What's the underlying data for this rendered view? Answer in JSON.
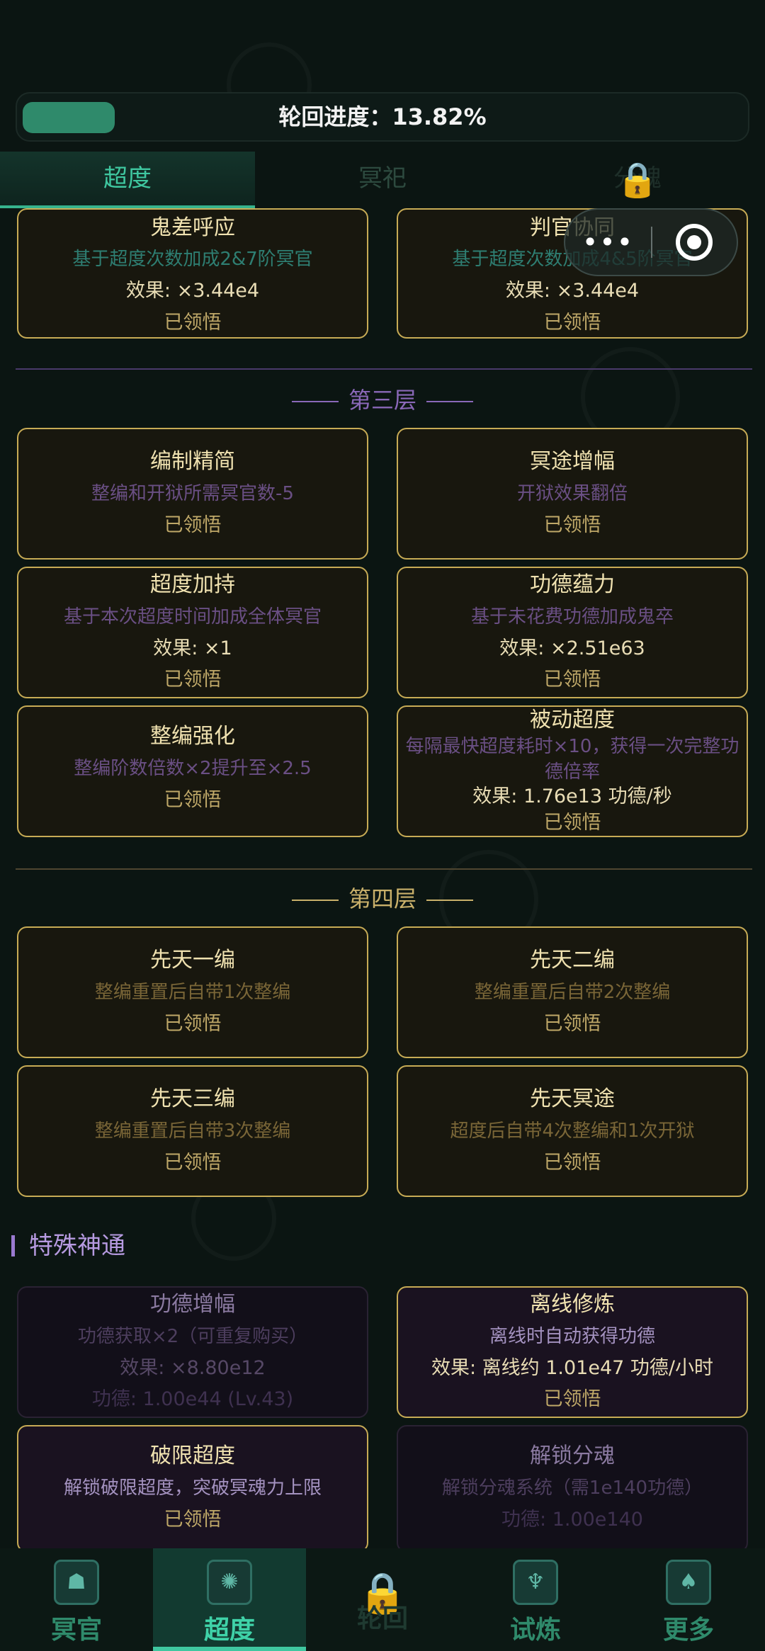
{
  "progress": {
    "label": "轮回进度：13.82%",
    "value": 0.1382
  },
  "tabs": {
    "t0": "超度",
    "t1": "冥祀",
    "t2": "分魂",
    "lock_icon": "lock-icon"
  },
  "capsule": {
    "dots": "•••"
  },
  "layer2": {
    "c1": {
      "title": "鬼差呼应",
      "desc": "基于超度次数加成2&7阶冥官",
      "effect": "效果: ×3.44e4",
      "status": "已领悟"
    },
    "c2": {
      "title": "判官协同",
      "desc": "基于超度次数加成4&5阶冥官",
      "effect": "效果: ×3.44e4",
      "status": "已领悟"
    }
  },
  "layer3": {
    "header": "第三层",
    "c1": {
      "title": "编制精简",
      "desc": "整编和开狱所需冥官数-5",
      "status": "已领悟"
    },
    "c2": {
      "title": "冥途增幅",
      "desc": "开狱效果翻倍",
      "status": "已领悟"
    },
    "c3": {
      "title": "超度加持",
      "desc": "基于本次超度时间加成全体冥官",
      "effect": "效果: ×1",
      "status": "已领悟"
    },
    "c4": {
      "title": "功德蕴力",
      "desc": "基于未花费功德加成鬼卒",
      "effect": "效果: ×2.51e63",
      "status": "已领悟"
    },
    "c5": {
      "title": "整编强化",
      "desc": "整编阶数倍数×2提升至×2.5",
      "status": "已领悟"
    },
    "c6": {
      "title": "被动超度",
      "desc": "每隔最快超度耗时×10，获得一次完整功德倍率",
      "effect": "效果: 1.76e13 功德/秒",
      "status": "已领悟"
    }
  },
  "layer4": {
    "header": "第四层",
    "c1": {
      "title": "先天一编",
      "desc": "整编重置后自带1次整编",
      "status": "已领悟"
    },
    "c2": {
      "title": "先天二编",
      "desc": "整编重置后自带2次整编",
      "status": "已领悟"
    },
    "c3": {
      "title": "先天三编",
      "desc": "整编重置后自带3次整编",
      "status": "已领悟"
    },
    "c4": {
      "title": "先天冥途",
      "desc": "超度后自带4次整编和1次开狱",
      "status": "已领悟"
    }
  },
  "special": {
    "header": "特殊神通",
    "c1": {
      "title": "功德增幅",
      "desc": "功德获取×2（可重复购买）",
      "effect": "效果: ×8.80e12",
      "status": "功德: 1.00e44 (Lv.43)"
    },
    "c2": {
      "title": "离线修炼",
      "desc": "离线时自动获得功德",
      "effect": "效果: 离线约 1.01e47 功德/小时",
      "status": "已领悟"
    },
    "c3": {
      "title": "破限超度",
      "desc": "解锁破限超度，突破冥魂力上限",
      "status": "已领悟"
    },
    "c4": {
      "title": "解锁分魂",
      "desc": "解锁分魂系统（需1e140功德）",
      "status": "功德: 1.00e140"
    }
  },
  "nav": {
    "n0": "冥官",
    "n1": "超度",
    "n2": "轮回",
    "n3": "试炼",
    "n4": "更多"
  },
  "colors": {
    "accent": "#3fc7a0",
    "gold": "#c7ab55",
    "purple": "#8a68b8"
  }
}
